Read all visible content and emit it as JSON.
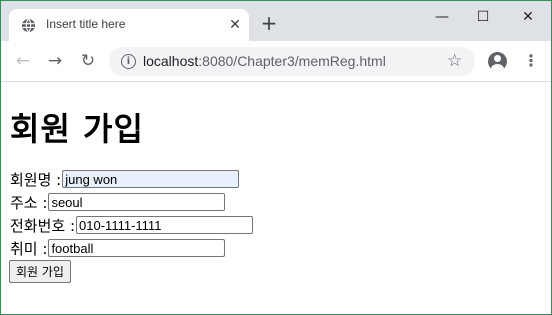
{
  "browser": {
    "tab_title": "Insert title here",
    "close_glyph": "✕",
    "new_tab_glyph": "+",
    "window_controls": {
      "minimize": "—",
      "maximize": "☐",
      "close": "✕"
    },
    "nav": {
      "back": "←",
      "forward": "→",
      "reload": "↻"
    },
    "url_host": "localhost",
    "url_rest": ":8080/Chapter3/memReg.html",
    "star_glyph": "☆",
    "menu_glyph": "⋮",
    "icons": [
      "globe-icon",
      "info-icon",
      "star-icon",
      "account-icon",
      "kebab-menu-icon"
    ]
  },
  "form": {
    "heading": "회원 가입",
    "fields": [
      {
        "label": "회원명 :",
        "value": "jung won"
      },
      {
        "label": "주소 :",
        "value": "seoul"
      },
      {
        "label": "전화번호 :",
        "value": "010-1111-1111"
      },
      {
        "label": "취미 :",
        "value": "football"
      }
    ],
    "submit_label": "회원 가입"
  },
  "colors": {
    "tabstrip_bg": "#dee1e6",
    "omnibox_bg": "#f1f3f4",
    "autofill_bg": "#e8f0fe",
    "window_border": "#3c8a5c"
  }
}
